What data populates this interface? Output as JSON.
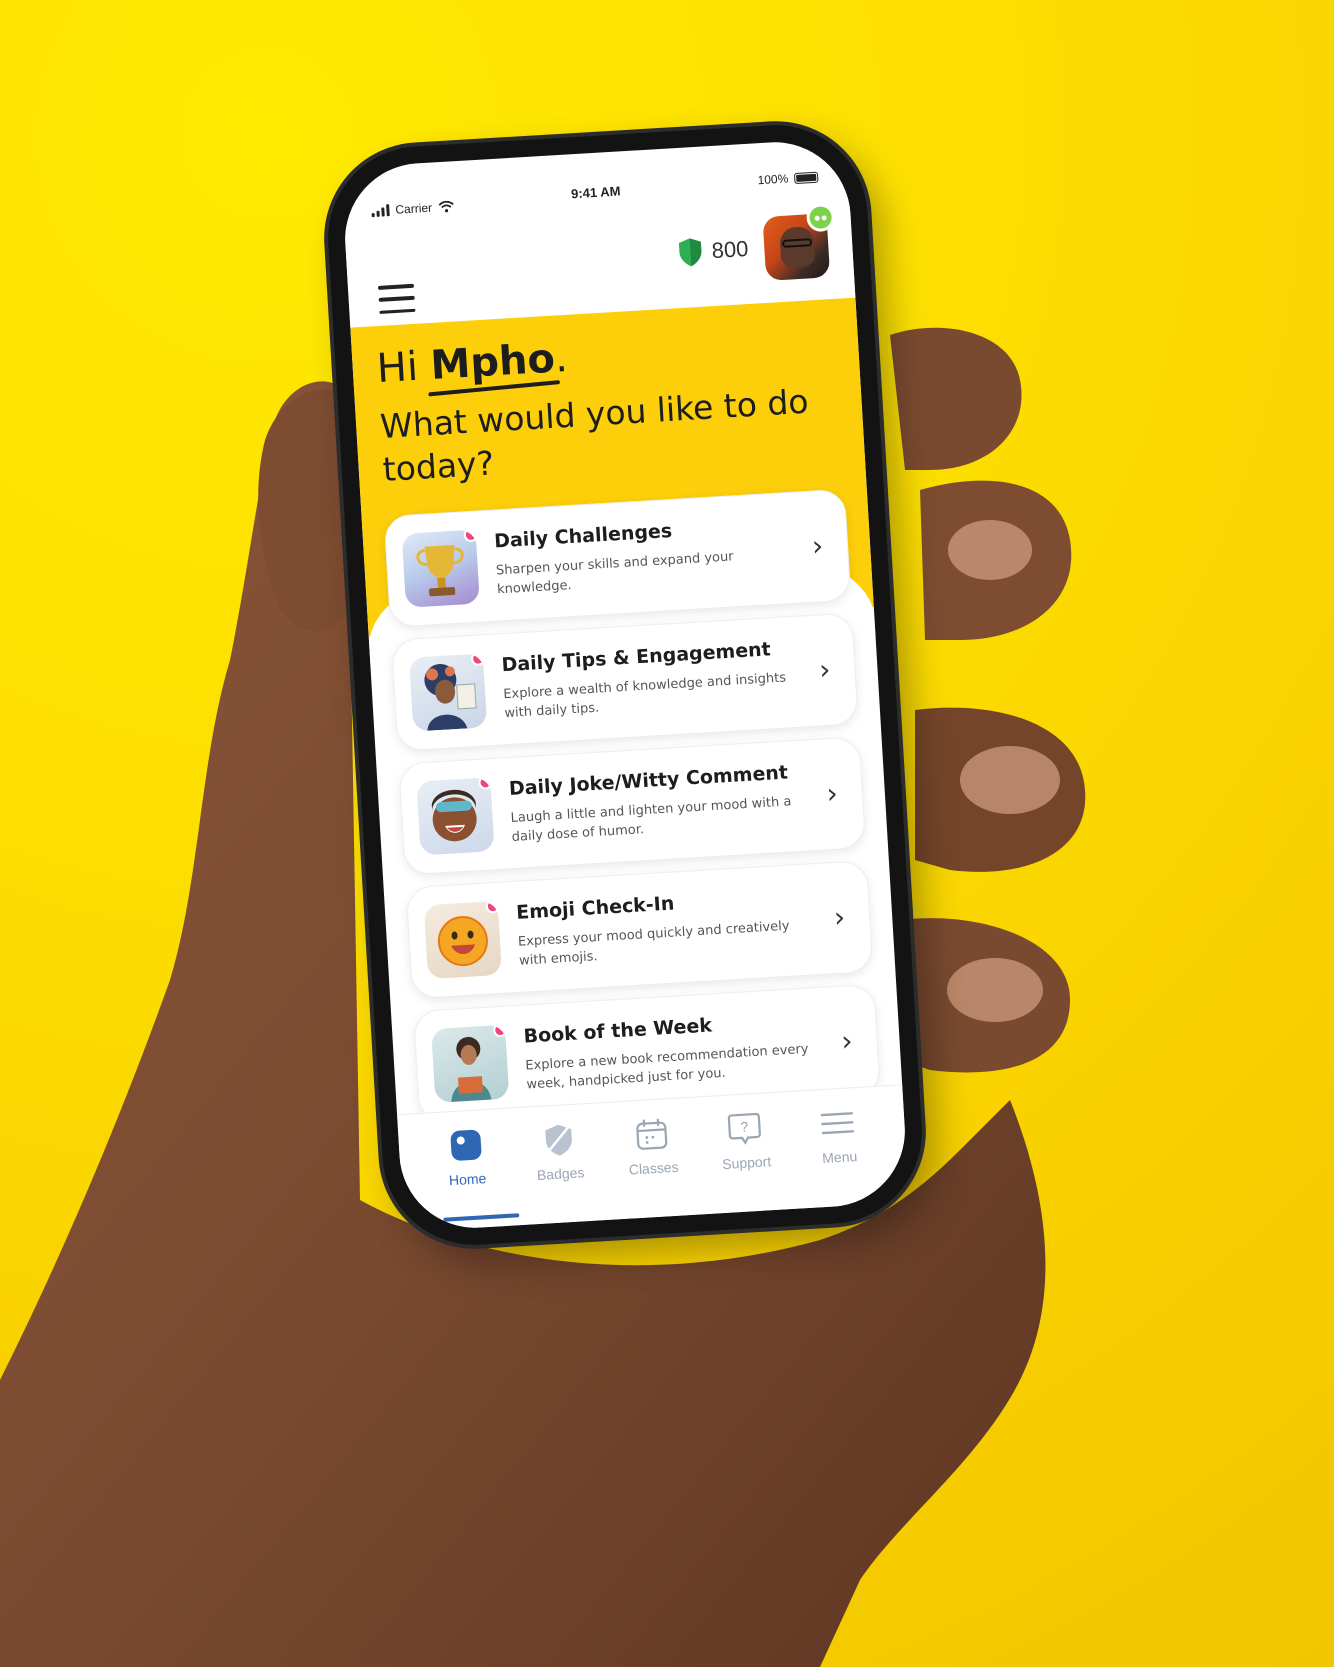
{
  "status_bar": {
    "carrier": "Carrier",
    "time": "9:41 AM",
    "battery": "100%"
  },
  "header": {
    "points": "800",
    "shield_color": "#2fae56"
  },
  "hero": {
    "greeting": "Hi",
    "name": "Mpho",
    "greeting_end": ".",
    "question": "What would you like to do today?"
  },
  "cards": [
    {
      "title": "Daily Challenges",
      "description": "Sharpen your skills and expand your knowledge."
    },
    {
      "title": "Daily Tips & Engagement",
      "description": "Explore a wealth of knowledge and insights with daily tips."
    },
    {
      "title": "Daily Joke/Witty Comment",
      "description": "Laugh a little and lighten your mood with a daily dose of humor."
    },
    {
      "title": "Emoji Check-In",
      "description": "Express your mood quickly and creatively with emojis."
    },
    {
      "title": "Book of the Week",
      "description": "Explore a new book recommendation every week, handpicked just for you."
    }
  ],
  "chevron": "›",
  "tabs": [
    {
      "label": "Home",
      "icon": "home-icon"
    },
    {
      "label": "Badges",
      "icon": "badge-icon"
    },
    {
      "label": "Classes",
      "icon": "calendar-icon"
    },
    {
      "label": "Support",
      "icon": "support-icon"
    },
    {
      "label": "Menu",
      "icon": "menu-icon"
    }
  ],
  "colors": {
    "background_yellow": "#fde000",
    "hero_yellow": "#fdce0a",
    "active_tab": "#2f67b4",
    "inactive_tab": "#9aa6b4",
    "notification_dot": "#f0457a"
  }
}
